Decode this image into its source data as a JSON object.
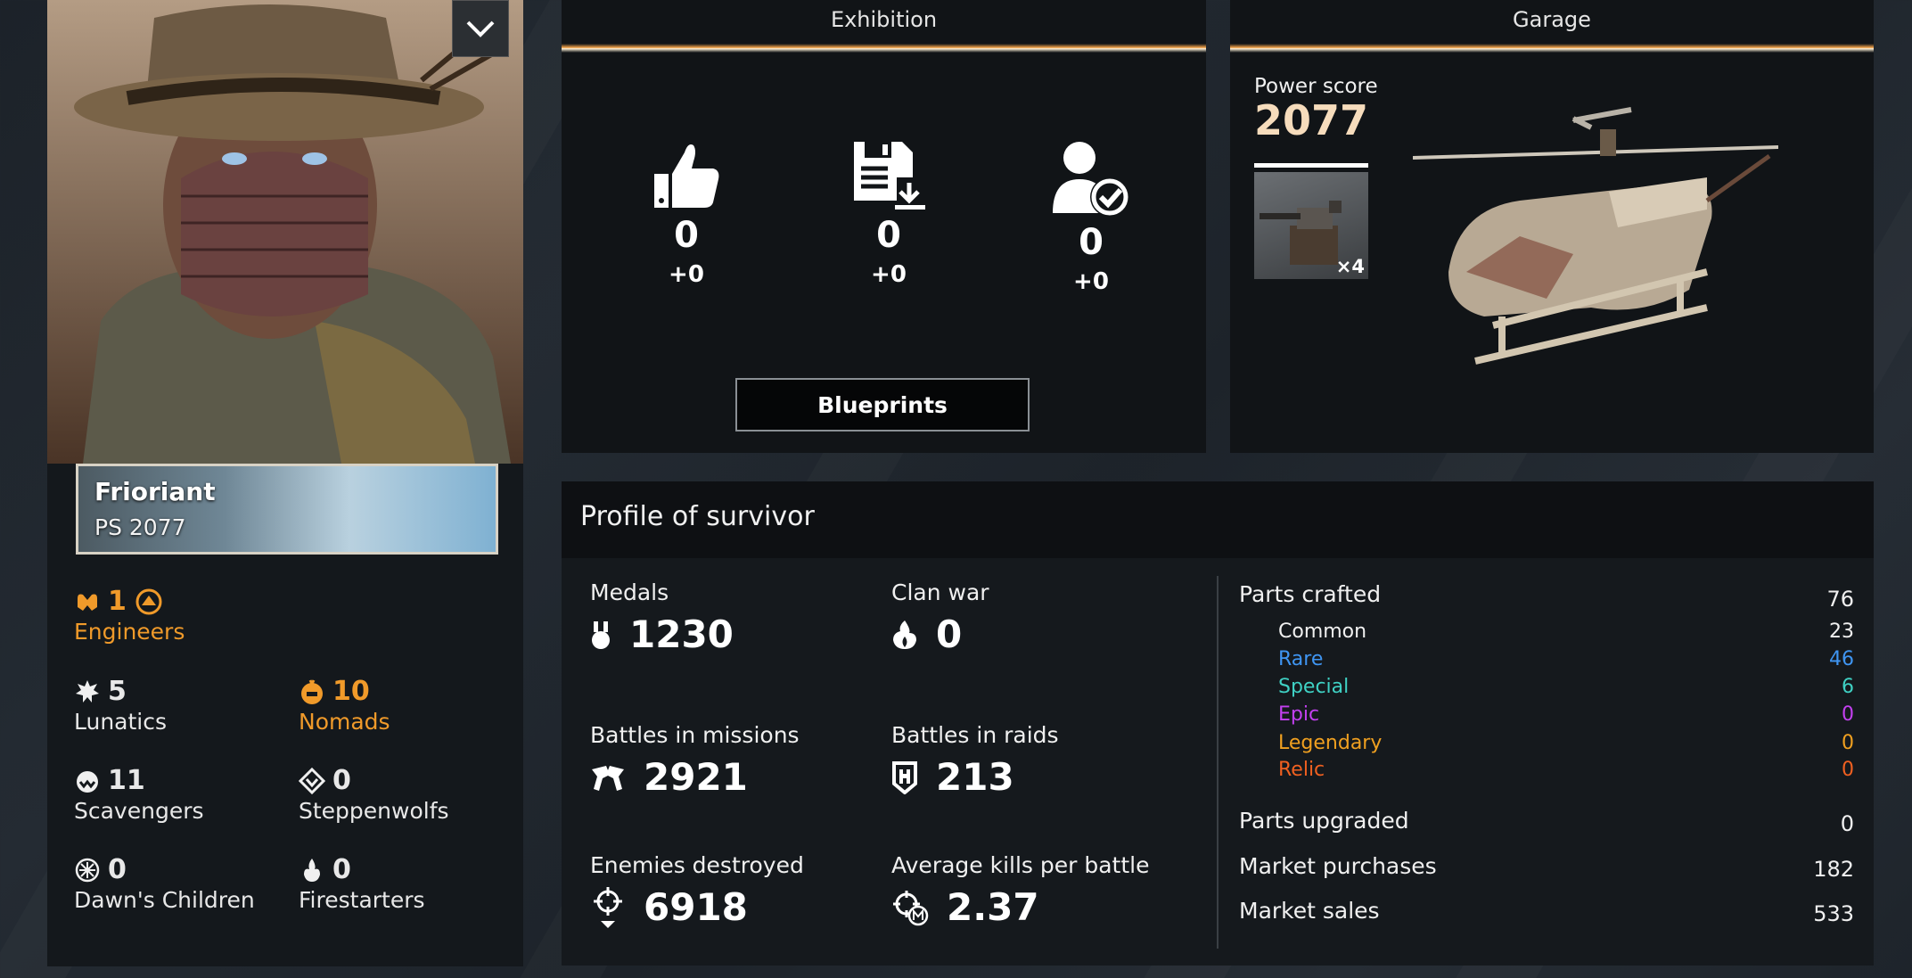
{
  "player": {
    "name": "Frioriant",
    "ps_label": "PS 2077"
  },
  "factions": {
    "main": {
      "level": "1",
      "name": "Engineers"
    },
    "list": [
      {
        "name": "Lunatics",
        "value": "5"
      },
      {
        "name": "Nomads",
        "value": "10"
      },
      {
        "name": "Scavengers",
        "value": "11"
      },
      {
        "name": "Steppenwolfs",
        "value": "0"
      },
      {
        "name": "Dawn's Children",
        "value": "0"
      },
      {
        "name": "Firestarters",
        "value": "0"
      }
    ]
  },
  "exhibition": {
    "title": "Exhibition",
    "stats": [
      {
        "icon": "thumbs-up-icon",
        "value": "0",
        "delta": "+0"
      },
      {
        "icon": "save-download-icon",
        "value": "0",
        "delta": "+0"
      },
      {
        "icon": "user-check-icon",
        "value": "0",
        "delta": "+0"
      }
    ],
    "blueprints_label": "Blueprints"
  },
  "garage": {
    "title": "Garage",
    "power_label": "Power score",
    "power_value": "2077",
    "weapon_count": "×4"
  },
  "profile": {
    "title": "Profile of survivor",
    "stats": {
      "medals": {
        "label": "Medals",
        "value": "1230"
      },
      "clan_war": {
        "label": "Clan war",
        "value": "0"
      },
      "missions": {
        "label": "Battles in missions",
        "value": "2921"
      },
      "raids": {
        "label": "Battles in raids",
        "value": "213"
      },
      "enemies": {
        "label": "Enemies destroyed",
        "value": "6918"
      },
      "avg_kills": {
        "label": "Average kills per battle",
        "value": "2.37"
      }
    },
    "parts_crafted": {
      "label": "Parts crafted",
      "value": "76"
    },
    "rarities": [
      {
        "name": "Common",
        "value": "23",
        "color": "#f0f0f0"
      },
      {
        "name": "Rare",
        "value": "46",
        "color": "#3f95f2"
      },
      {
        "name": "Special",
        "value": "6",
        "color": "#3fd1c4"
      },
      {
        "name": "Epic",
        "value": "0",
        "color": "#c340f0"
      },
      {
        "name": "Legendary",
        "value": "0",
        "color": "#f0a020"
      },
      {
        "name": "Relic",
        "value": "0",
        "color": "#f06020"
      }
    ],
    "parts_upgraded": {
      "label": "Parts upgraded",
      "value": "0"
    },
    "market_purchases": {
      "label": "Market purchases",
      "value": "182"
    },
    "market_sales": {
      "label": "Market sales",
      "value": "533"
    }
  }
}
